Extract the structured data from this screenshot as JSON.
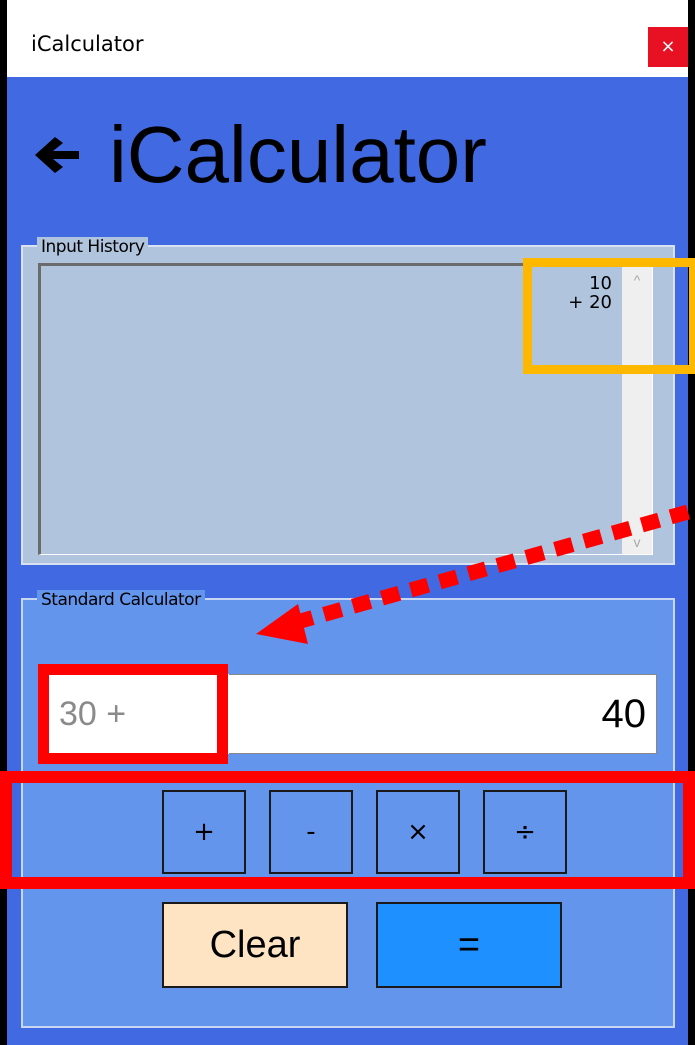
{
  "window": {
    "title": "iCalculator",
    "close_glyph": "×"
  },
  "header": {
    "back_icon": "back-arrow-icon",
    "title": "iCalculator"
  },
  "history": {
    "legend": "Input History",
    "lines": [
      "10",
      "+ 20"
    ],
    "scroll_up_glyph": "^",
    "scroll_down_glyph": "v"
  },
  "calculator": {
    "legend": "Standard Calculator",
    "expression": "30 +",
    "value": "40",
    "operators": {
      "plus": "+",
      "minus": "-",
      "multiply": "×",
      "divide": "÷"
    },
    "clear_label": "Clear",
    "equals_label": "="
  },
  "colors": {
    "window_bg": "#4169E1",
    "history_bg": "#B0C4DE",
    "calc_bg": "#6495ED",
    "clear_bg": "#FFE4C4",
    "equals_bg": "#1E90FF",
    "close_bg": "#E81123",
    "annotation_red": "#FF0000",
    "annotation_yellow": "#FFB800"
  }
}
